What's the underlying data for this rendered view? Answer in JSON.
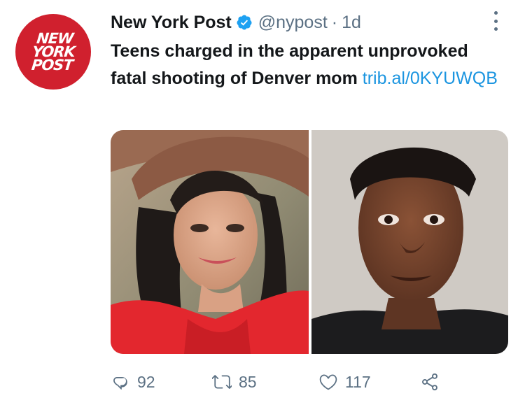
{
  "tweet": {
    "author": {
      "name": "New York Post",
      "handle": "@nypost",
      "separator": "·",
      "time": "1d",
      "verified": true,
      "avatar_logo_lines": [
        "NEW",
        "YORK",
        "POST"
      ],
      "avatar_color": "#d0202e"
    },
    "text": "Teens charged in the apparent unprovoked fatal shooting of Denver mom",
    "link": "trib.al/0KYUWQB",
    "media": {
      "count": 2,
      "images": [
        {
          "icon": "photo-woman-red-dress-hat"
        },
        {
          "icon": "photo-young-man-mugshot"
        }
      ]
    },
    "actions": {
      "replies": "92",
      "retweets": "85",
      "likes": "117"
    }
  },
  "colors": {
    "accent_link": "#1b95e0",
    "verified_badge": "#1da1f2",
    "secondary_text": "#5b7083"
  }
}
